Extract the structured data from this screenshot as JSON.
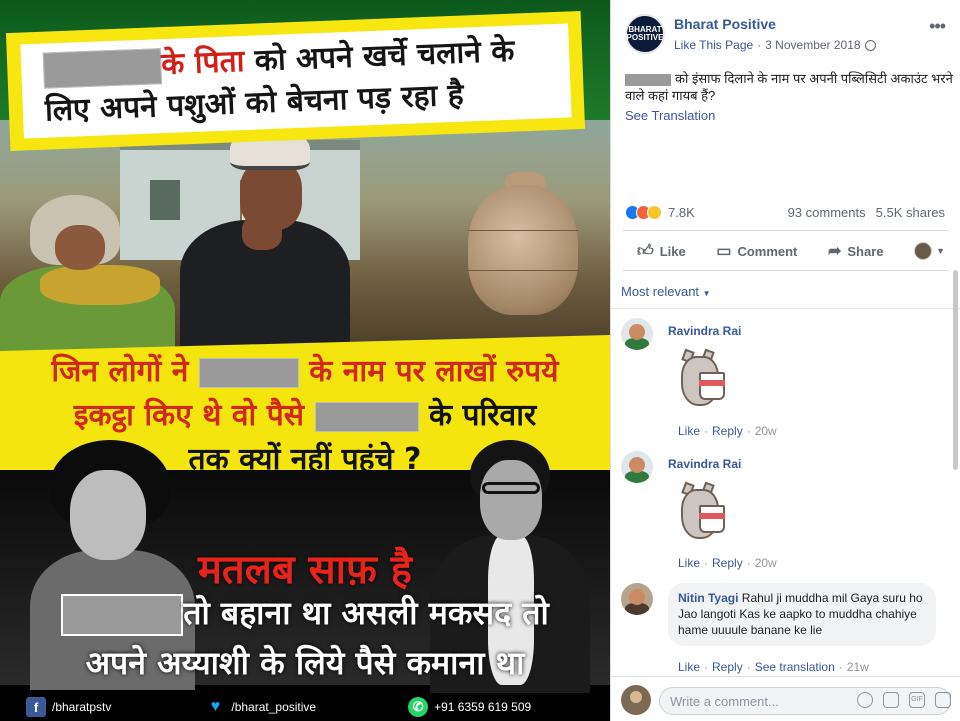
{
  "poster": {
    "top_line1_red": "के पिता",
    "top_line1_rest": " को अपने खर्चे चलाने के",
    "top_line2": "लिए अपने पशुओं को बेचना पड़ रहा है",
    "mid_line1_a": "जिन लोगों ने",
    "mid_line1_b": "के नाम पर लाखों रुपये",
    "mid_line2_a": "इकट्ठा किए थे वो पैसे",
    "mid_line2_b": "के परिवार",
    "mid_line3": "तक क्यों नहीं पहुंचे ?",
    "clear": "मतलब साफ़ है",
    "bottom_line1": "तो बहाना था असली मकसद तो",
    "bottom_line2": "अपने अय्याशी के लिये पैसे कमाना था",
    "footer": {
      "facebook": "/bharatpstv",
      "twitter": "/bharat_positive",
      "whatsapp": "+91 6359 619 509"
    }
  },
  "post": {
    "page_name": "Bharat Positive",
    "avatar_text": "BHARAT POSITIVE",
    "like_page": "Like This Page",
    "date": "3 November 2018",
    "text": "को इंसाफ दिलाने के नाम पर अपनी पब्लिसिटी अकाउंट भरने वाले कहां गायब हैं?",
    "see_translation": "See Translation",
    "reactions_count": "7.8K",
    "comments_count": "93 comments",
    "shares_count": "5.5K shares",
    "actions": {
      "like": "Like",
      "comment": "Comment",
      "share": "Share"
    }
  },
  "comments_section": {
    "sort_label": "Most relevant",
    "comments": [
      {
        "name": "Ravindra Rai",
        "like": "Like",
        "reply": "Reply",
        "time": "20w"
      },
      {
        "name": "Ravindra Rai",
        "like": "Like",
        "reply": "Reply",
        "time": "20w"
      },
      {
        "name": "Nitin Tyagi",
        "text": "Rahul ji muddha mil Gaya suru ho Jao langoti Kas ke aapko to muddha chahiye hame uuuule banane ke lie",
        "like": "Like",
        "reply": "Reply",
        "see_translation": "See translation",
        "time": "21w"
      }
    ],
    "composer_placeholder": "Write a comment..."
  },
  "colors": {
    "link": "#385898",
    "poster_red": "#d0201a",
    "poster_yellow": "#f4e50e"
  }
}
